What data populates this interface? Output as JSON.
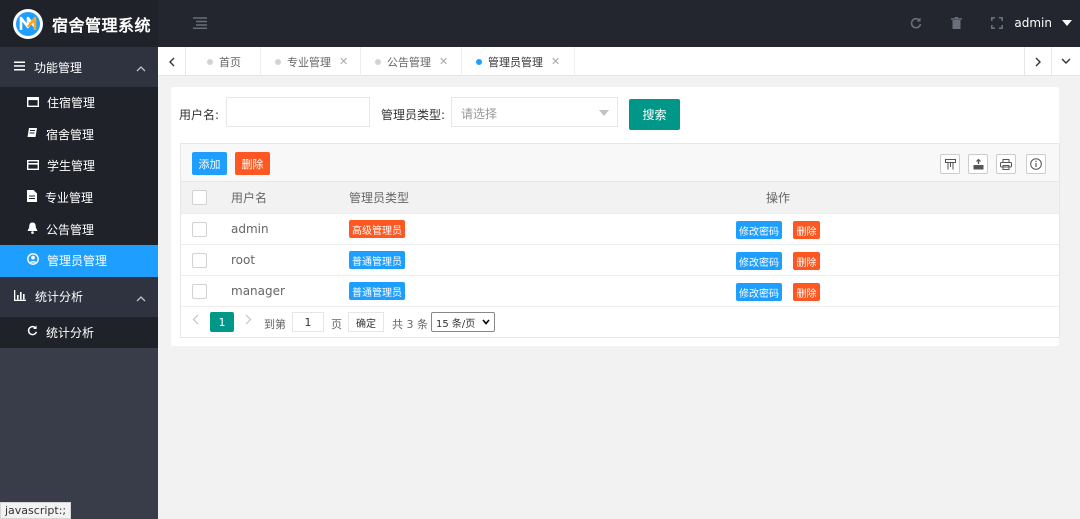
{
  "header": {
    "app_title": "宿舍管理系统",
    "user": "admin"
  },
  "sidebar": {
    "groups": [
      {
        "label": "功能管理",
        "icon": "list-icon",
        "items": [
          {
            "label": "住宿管理",
            "icon": "window-icon"
          },
          {
            "label": "宿舍管理",
            "icon": "book-icon"
          },
          {
            "label": "学生管理",
            "icon": "card-icon"
          },
          {
            "label": "专业管理",
            "icon": "file-icon"
          },
          {
            "label": "公告管理",
            "icon": "bell-icon",
            "active": false
          },
          {
            "label": "管理员管理",
            "icon": "user-circle-icon",
            "active": true
          }
        ]
      },
      {
        "label": "统计分析",
        "icon": "bar-chart-icon",
        "items": [
          {
            "label": "统计分析",
            "icon": "refresh-icon"
          }
        ]
      }
    ],
    "status_text": "javascript:;"
  },
  "tabs": [
    {
      "label": "首页",
      "closable": false,
      "active": false
    },
    {
      "label": "专业管理",
      "closable": true,
      "active": false
    },
    {
      "label": "公告管理",
      "closable": true,
      "active": false
    },
    {
      "label": "管理员管理",
      "closable": true,
      "active": true
    }
  ],
  "search": {
    "username_label": "用户名:",
    "username_value": "",
    "type_label": "管理员类型:",
    "type_placeholder": "请选择",
    "search_button": "搜索"
  },
  "toolbar": {
    "add_label": "添加",
    "delete_label": "删除"
  },
  "table": {
    "columns": [
      "用户名",
      "管理员类型",
      "操作"
    ],
    "rows": [
      {
        "username": "admin",
        "type": "高级管理员",
        "type_color": "#ff5722"
      },
      {
        "username": "root",
        "type": "普通管理员",
        "type_color": "#1e9fff"
      },
      {
        "username": "manager",
        "type": "普通管理员",
        "type_color": "#1e9fff"
      }
    ],
    "action_edit": "修改密码",
    "action_delete": "删除"
  },
  "pager": {
    "current_page": "1",
    "goto_prefix": "到第",
    "goto_value": "1",
    "goto_suffix": "页",
    "confirm": "确定",
    "total": "共 3 条",
    "page_size": "15 条/页"
  },
  "colors": {
    "header_bg": "#23262e",
    "sidebar_bg": "#393d49",
    "active_blue": "#1e9fff",
    "primary_green": "#009688",
    "danger_orange": "#ff5722"
  }
}
